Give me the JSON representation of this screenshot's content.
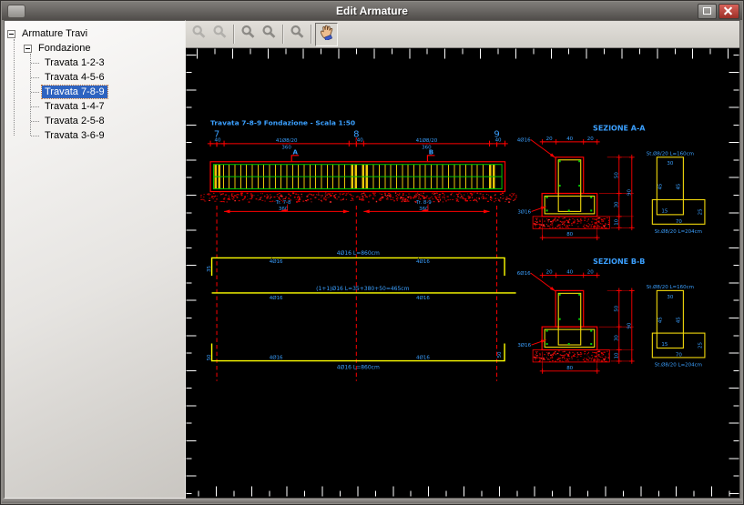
{
  "window": {
    "title": "Edit Armature"
  },
  "tree": {
    "root": "Armature Travi",
    "group": "Fondazione",
    "selected_index": 2,
    "items": [
      {
        "label": "Travata 1-2-3"
      },
      {
        "label": "Travata 4-5-6"
      },
      {
        "label": "Travata 7-8-9"
      },
      {
        "label": "Travata 1-4-7"
      },
      {
        "label": "Travata 2-5-8"
      },
      {
        "label": "Travata 3-6-9"
      }
    ]
  },
  "toolbar": {
    "buttons": [
      {
        "icon": "zoom-realtime",
        "disabled": true,
        "active": false,
        "sep_after": false
      },
      {
        "icon": "zoom-extents",
        "disabled": true,
        "active": false,
        "sep_after": true
      },
      {
        "icon": "zoom-in",
        "disabled": false,
        "active": false,
        "sep_after": false
      },
      {
        "icon": "zoom-out",
        "disabled": false,
        "active": false,
        "sep_after": true
      },
      {
        "icon": "zoom-window",
        "disabled": false,
        "active": false,
        "sep_after": true
      },
      {
        "icon": "pan",
        "disabled": false,
        "active": true,
        "sep_after": false
      }
    ]
  },
  "canvas": {
    "drawing": {
      "title": "Travata 7-8-9 Fondazione - Scala 1:50",
      "grid": [
        "7",
        "8",
        "9"
      ],
      "dims": {
        "support": "40",
        "stirrups": "41Ø8/20",
        "span": "360"
      },
      "cuts": [
        "A",
        "B"
      ],
      "span_tags": [
        {
          "name": "Tr. 7-8",
          "len": "360"
        },
        {
          "name": "Tr. 8-9",
          "len": "360"
        }
      ],
      "bars": {
        "top_label": "4Ø16 L=860cm",
        "mid_label": "(1+1)Ø16 L=35+380+50=465cm",
        "bottom_label": "4Ø16 L=860cm",
        "tick": "4Ø16",
        "hook_top": "35",
        "hook_bottom": "50"
      },
      "sections": [
        {
          "title": "SEZIONE A-A",
          "top_dims": [
            "20",
            "40",
            "20"
          ],
          "side_dims": [
            "50",
            "30",
            "10"
          ],
          "side_total": "90",
          "bottom_dim": "80",
          "leader_top": "4Ø16",
          "leader_bottom": "3Ø16",
          "stirrup": {
            "top_label": "St.Ø8/20 L=160cm",
            "bottom_label": "St.Ø8/20 L=204cm",
            "w": "30",
            "s1": "45",
            "s2": "45",
            "lap": "15",
            "fs": "25",
            "fw": "70"
          }
        },
        {
          "title": "SEZIONE B-B",
          "top_dims": [
            "20",
            "40",
            "20"
          ],
          "side_dims": [
            "50",
            "30",
            "10"
          ],
          "side_total": "90",
          "bottom_dim": "80",
          "leader_top": "6Ø16",
          "leader_bottom": "3Ø16",
          "stirrup": {
            "top_label": "St.Ø8/20 L=160cm",
            "bottom_label": "St.Ø8/20 L=204cm",
            "w": "30",
            "s1": "45",
            "s2": "45",
            "lap": "15",
            "fs": "25",
            "fw": "70"
          }
        }
      ]
    }
  }
}
